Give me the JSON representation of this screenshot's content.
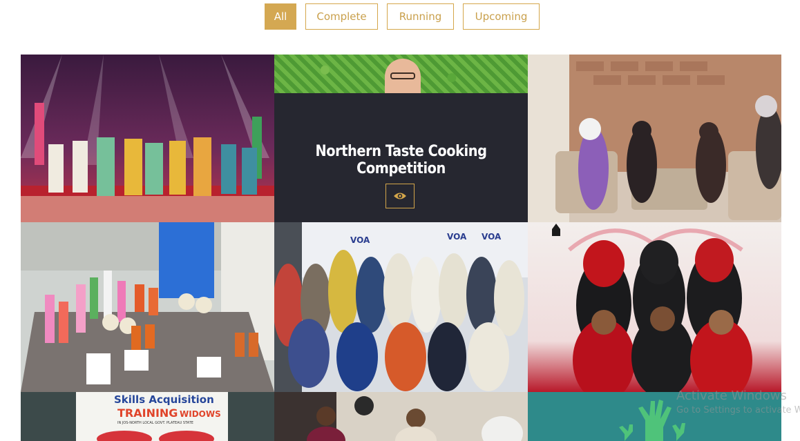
{
  "filters": {
    "all": "All",
    "complete": "Complete",
    "running": "Running",
    "upcoming": "Upcoming",
    "active": "All"
  },
  "portfolio": {
    "hover_item": {
      "title": "Northern Taste Cooking Competition",
      "icon": "eye-icon"
    },
    "tile_texts": {
      "skills_banner_line1": "Skills Acquisition",
      "skills_banner_line2": "TRAINING",
      "skills_banner_line3": "WIDOWS",
      "skills_banner_sub": "IN JOS-NORTH LOCAL GOVT. PLATEAU STATE",
      "voa_logo": "VOA"
    }
  },
  "watermark": {
    "line1": "Activate Windows",
    "line2": "Go to Settings to activate W"
  },
  "colors": {
    "accent": "#d4a852",
    "hover_bg": "#262730"
  }
}
